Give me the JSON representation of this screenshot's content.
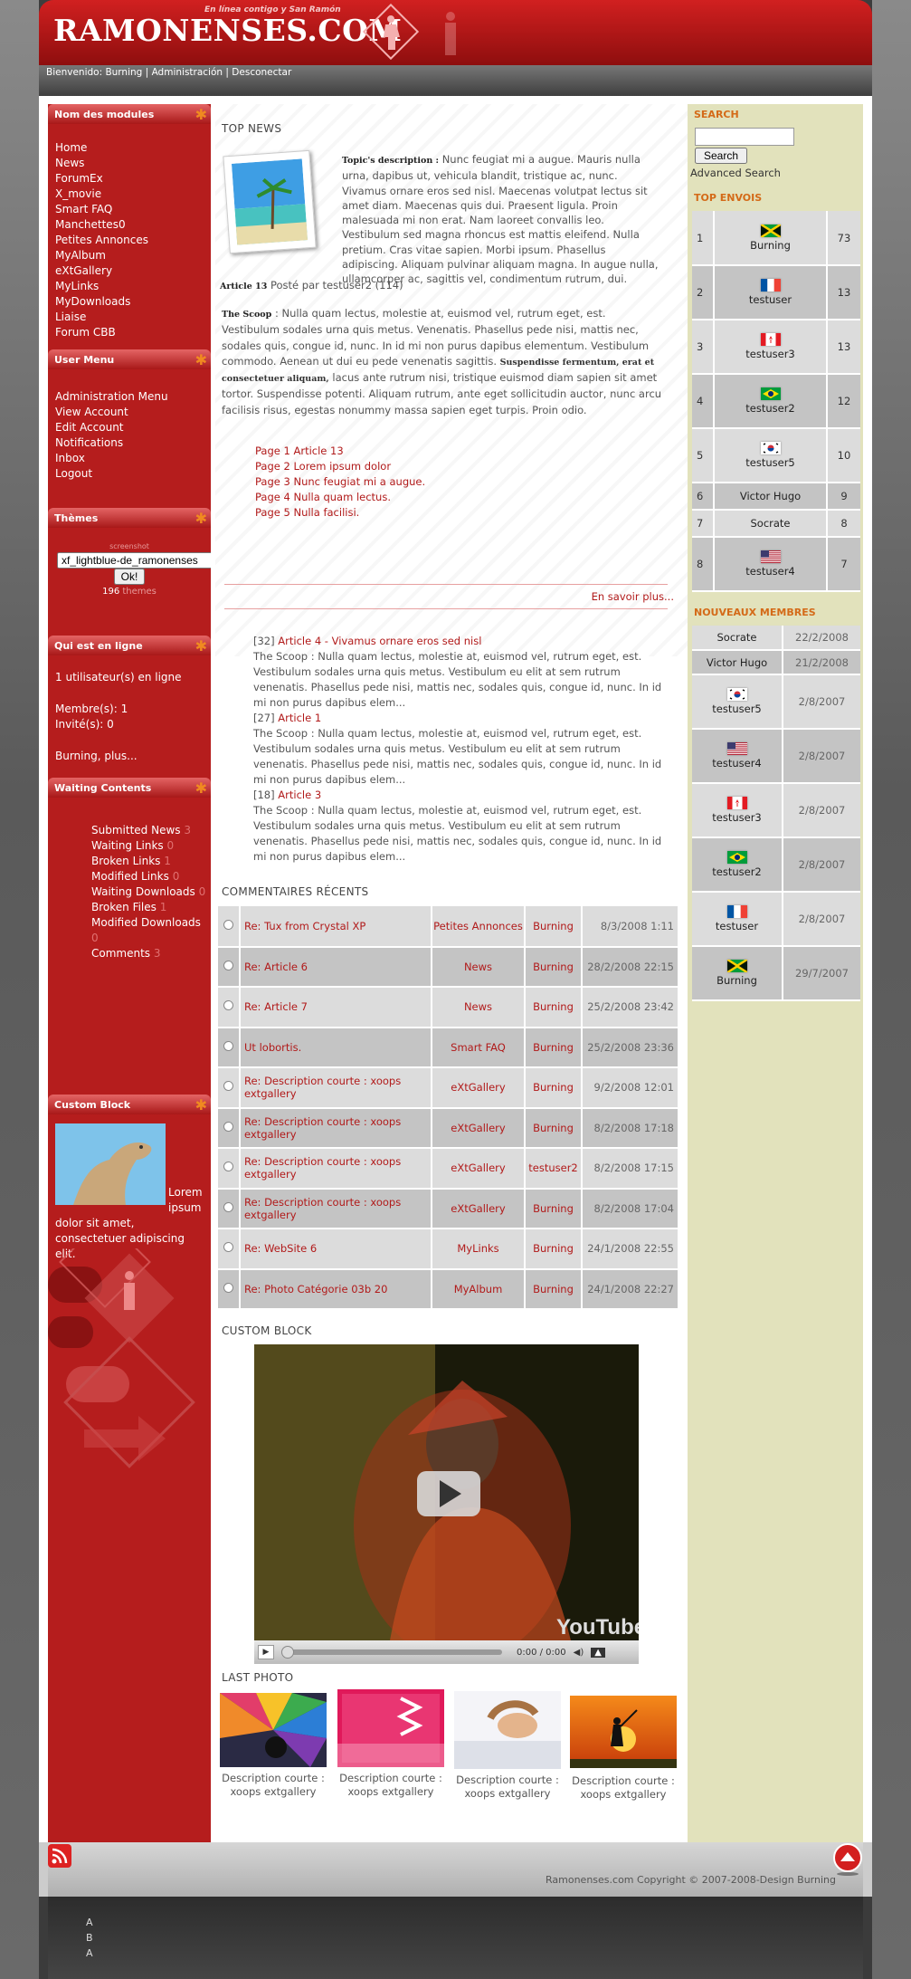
{
  "header": {
    "title": "RAMONENSES.COM",
    "slogan": "En línea contigo y San Ramón"
  },
  "userbar": {
    "welcome": "Bienvenido: Burning",
    "sep1": "|",
    "admin": "Administración",
    "sep2": "|",
    "logout": "Desconectar"
  },
  "left": {
    "modules_title": "Nom des modules",
    "modules": [
      "Home",
      "News",
      "ForumEx",
      "X_movie",
      "Smart FAQ",
      "Manchettes0",
      "Petites Annonces",
      "MyAlbum",
      "eXtGallery",
      "MyLinks",
      "MyDownloads",
      "Liaise",
      "Forum CBB"
    ],
    "user_title": "User Menu",
    "user_items": [
      "Administration Menu",
      "View Account",
      "Edit Account",
      "Notifications",
      "Inbox",
      "Logout"
    ],
    "themes_title": "Thèmes",
    "themes_caption": "screenshot",
    "theme_selected": "xf_lightblue-de_ramonenses",
    "theme_button": "Ok!",
    "theme_count": "196",
    "theme_count_label": "themes",
    "online_title": "Qui est en ligne",
    "online_count": "1",
    "online_text": "utilisateur(s) en ligne",
    "members": "Membre(s): 1",
    "guests": "Invité(s): 0",
    "online_more": "Burning, plus...",
    "waiting_title": "Waiting Contents",
    "waiting": [
      {
        "label": "Submitted News",
        "count": "3"
      },
      {
        "label": "Waiting Links",
        "count": "0"
      },
      {
        "label": "Broken Links",
        "count": "1"
      },
      {
        "label": "Modified Links",
        "count": "0"
      },
      {
        "label": "Waiting Downloads",
        "count": "0"
      },
      {
        "label": "Broken Files",
        "count": "1"
      },
      {
        "label": "Modified Downloads",
        "count": "0"
      },
      {
        "label": "Comments",
        "count": "3"
      }
    ],
    "custom_title": "Custom Block",
    "custom_text": "Lorem ipsum dolor sit amet, consectetuer adipiscing elit."
  },
  "center": {
    "topnews_title": "TOP NEWS",
    "topic_label": "Topic's description :",
    "topic_text": "Nunc feugiat mi a augue. Mauris nulla urna, dapibus ut, vehicula blandit, tristique ac, nunc. Vivamus ornare eros sed nisl. Maecenas volutpat lectus sit amet diam. Maecenas quis dui. Praesent ligula. Proin malesuada mi non erat. Nam laoreet convallis leo. Vestibulum sed magna rhoncus est mattis eleifend. Nulla pretium. Cras vitae sapien. Morbi ipsum. Phasellus adipiscing. Aliquam pulvinar aliquam magna. In augue nulla, ullamcorper ac, sagittis vel, condimentum rutrum, dui.",
    "article_label": "Article 13",
    "article_meta": "Posté par testuser2 (114)",
    "scoop_label": "The Scoop",
    "scoop_text1": ": Nulla quam lectus, molestie at, euismod vel, rutrum eget, est. Vestibulum sodales urna quis metus. Venenatis. Phasellus pede nisi, mattis nec, sodales quis, congue id, nunc. In id mi non purus dapibus elementum. Vestibulum commodo. Aenean ut dui eu pede venenatis sagittis.",
    "scoop_bold": "Suspendisse fermentum, erat et consectetuer aliquam,",
    "scoop_text2": "lacus ante rutrum nisi, tristique euismod diam sapien sit amet tortor. Suspendisse potenti. Aliquam rutrum, ante eget sollicitudin auctor, nunc arcu facilisis risus, egestas nonummy massa sapien eget turpis. Proin odio.",
    "pages": [
      "Page 1 Article 13",
      "Page 2 Lorem ipsum dolor",
      "Page 3 Nunc feugiat mi a augue.",
      "Page 4 Nulla quam lectus.",
      "Page 5 Nulla facilisi."
    ],
    "more": "En savoir plus...",
    "news": [
      {
        "num": "[32]",
        "title": "Article 4 - Vivamus ornare eros sed nisl",
        "text": "The Scoop : Nulla quam lectus, molestie at, euismod vel, rutrum eget, est. Vestibulum sodales urna quis metus. Vestibulum eu elit at sem rutrum venenatis. Phasellus pede nisi, mattis nec, sodales quis, congue id, nunc. In id mi non purus dapibus elem..."
      },
      {
        "num": "[27]",
        "title": "Article 1",
        "text": "The Scoop : Nulla quam lectus, molestie at, euismod vel, rutrum eget, est. Vestibulum sodales urna quis metus. Vestibulum eu elit at sem rutrum venenatis. Phasellus pede nisi, mattis nec, sodales quis, congue id, nunc. In id mi non purus dapibus elem..."
      },
      {
        "num": "[18]",
        "title": "Article 3",
        "text": "The Scoop : Nulla quam lectus, molestie at, euismod vel, rutrum eget, est. Vestibulum sodales urna quis metus. Vestibulum eu elit at sem rutrum venenatis. Phasellus pede nisi, mattis nec, sodales quis, congue id, nunc. In id mi non purus dapibus elem..."
      }
    ],
    "comments_title": "COMMENTAIRES RÉCENTS",
    "comments": [
      {
        "title": "Re: Tux from Crystal XP",
        "module": "Petites Annonces",
        "user": "Burning",
        "date": "8/3/2008 1:11"
      },
      {
        "title": "Re: Article 6",
        "module": "News",
        "user": "Burning",
        "date": "28/2/2008 22:15"
      },
      {
        "title": "Re: Article 7",
        "module": "News",
        "user": "Burning",
        "date": "25/2/2008 23:42"
      },
      {
        "title": "Ut lobortis.",
        "module": "Smart FAQ",
        "user": "Burning",
        "date": "25/2/2008 23:36"
      },
      {
        "title": "Re: Description courte : xoops extgallery",
        "module": "eXtGallery",
        "user": "Burning",
        "date": "9/2/2008 12:01"
      },
      {
        "title": "Re: Description courte : xoops extgallery",
        "module": "eXtGallery",
        "user": "Burning",
        "date": "8/2/2008 17:18"
      },
      {
        "title": "Re: Description courte : xoops extgallery",
        "module": "eXtGallery",
        "user": "testuser2",
        "date": "8/2/2008 17:15"
      },
      {
        "title": "Re: Description courte : xoops extgallery",
        "module": "eXtGallery",
        "user": "Burning",
        "date": "8/2/2008 17:04"
      },
      {
        "title": "Re: WebSite 6",
        "module": "MyLinks",
        "user": "Burning",
        "date": "24/1/2008 22:55"
      },
      {
        "title": "Re: Photo Catégorie 03b 20",
        "module": "MyAlbum",
        "user": "Burning",
        "date": "24/1/2008 22:27"
      }
    ],
    "custom_title": "CUSTOM BLOCK",
    "video_time": "0:00 / 0:00",
    "video_brand": "YouTube",
    "photo_title": "LAST PHOTO",
    "photos": [
      "Description courte : xoops extgallery",
      "Description courte : xoops extgallery",
      "Description courte : xoops extgallery",
      "Description courte : xoops extgallery"
    ]
  },
  "right": {
    "search_title": "SEARCH",
    "search_button": "Search",
    "advanced": "Advanced Search",
    "top_title": "TOP ENVOIS",
    "top": [
      {
        "rank": "1",
        "user": "Burning",
        "flag": "jm",
        "count": "73"
      },
      {
        "rank": "2",
        "user": "testuser",
        "flag": "fr",
        "count": "13"
      },
      {
        "rank": "3",
        "user": "testuser3",
        "flag": "ca",
        "count": "13"
      },
      {
        "rank": "4",
        "user": "testuser2",
        "flag": "br",
        "count": "12"
      },
      {
        "rank": "5",
        "user": "testuser5",
        "flag": "kr",
        "count": "10"
      },
      {
        "rank": "6",
        "user": "Victor Hugo",
        "flag": "",
        "count": "9"
      },
      {
        "rank": "7",
        "user": "Socrate",
        "flag": "",
        "count": "8"
      },
      {
        "rank": "8",
        "user": "testuser4",
        "flag": "us",
        "count": "7"
      }
    ],
    "new_title": "NOUVEAUX MEMBRES",
    "new_members": [
      {
        "user": "Socrate",
        "flag": "",
        "date": "22/2/2008"
      },
      {
        "user": "Victor Hugo",
        "flag": "",
        "date": "21/2/2008"
      },
      {
        "user": "testuser5",
        "flag": "kr",
        "date": "2/8/2007"
      },
      {
        "user": "testuser4",
        "flag": "us",
        "date": "2/8/2007"
      },
      {
        "user": "testuser3",
        "flag": "ca",
        "date": "2/8/2007"
      },
      {
        "user": "testuser2",
        "flag": "br",
        "date": "2/8/2007"
      },
      {
        "user": "testuser",
        "flag": "fr",
        "date": "2/8/2007"
      },
      {
        "user": "Burning",
        "flag": "jm",
        "date": "29/7/2007"
      }
    ]
  },
  "footer": {
    "copyright": "Ramonenses.com Copyright © 2007-2008-Design Burning",
    "lines": [
      "A",
      "B",
      "A"
    ]
  }
}
